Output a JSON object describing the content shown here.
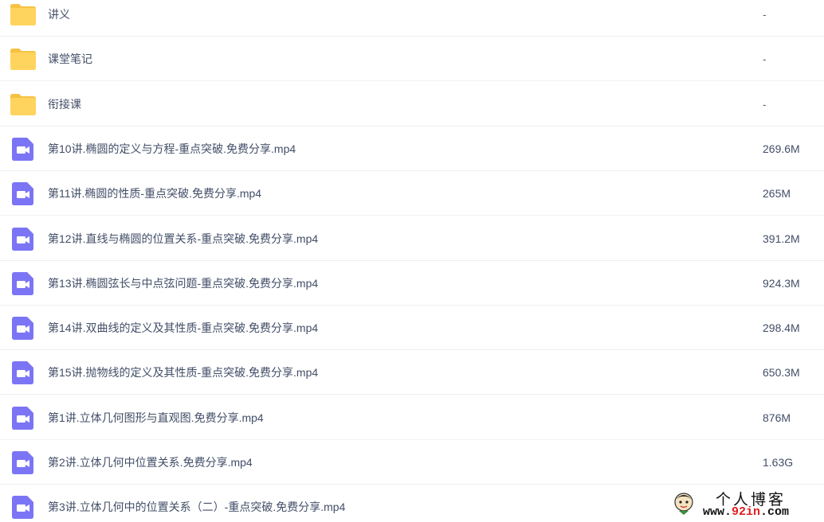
{
  "files": [
    {
      "type": "folder",
      "name": "讲义",
      "size": "-"
    },
    {
      "type": "folder",
      "name": "课堂笔记",
      "size": "-"
    },
    {
      "type": "folder",
      "name": "衔接课",
      "size": "-"
    },
    {
      "type": "video",
      "name": "第10讲.椭圆的定义与方程-重点突破.免费分享.mp4",
      "size": "269.6M"
    },
    {
      "type": "video",
      "name": "第11讲.椭圆的性质-重点突破.免费分享.mp4",
      "size": "265M"
    },
    {
      "type": "video",
      "name": "第12讲.直线与椭圆的位置关系-重点突破.免费分享.mp4",
      "size": "391.2M"
    },
    {
      "type": "video",
      "name": "第13讲.椭圆弦长与中点弦问题-重点突破.免费分享.mp4",
      "size": "924.3M"
    },
    {
      "type": "video",
      "name": "第14讲.双曲线的定义及其性质-重点突破.免费分享.mp4",
      "size": "298.4M"
    },
    {
      "type": "video",
      "name": "第15讲.抛物线的定义及其性质-重点突破.免费分享.mp4",
      "size": "650.3M"
    },
    {
      "type": "video",
      "name": "第1讲.立体几何图形与直观图.免费分享.mp4",
      "size": "876M"
    },
    {
      "type": "video",
      "name": "第2讲.立体几何中位置关系.免费分享.mp4",
      "size": "1.63G"
    },
    {
      "type": "video",
      "name": "第3讲.立体几何中的位置关系（二）-重点突破.免费分享.mp4",
      "size": ""
    }
  ],
  "icons": {
    "folder": "folder-icon",
    "video": "video-file-icon"
  },
  "colors": {
    "folder": "#ffd45e",
    "folder_tab": "#f5c242",
    "video": "#7b75f5",
    "text": "#424e67"
  },
  "watermark": {
    "title": "个人博客",
    "url_prefix": "www.",
    "url_highlight": "92in",
    "url_suffix": ".com"
  }
}
